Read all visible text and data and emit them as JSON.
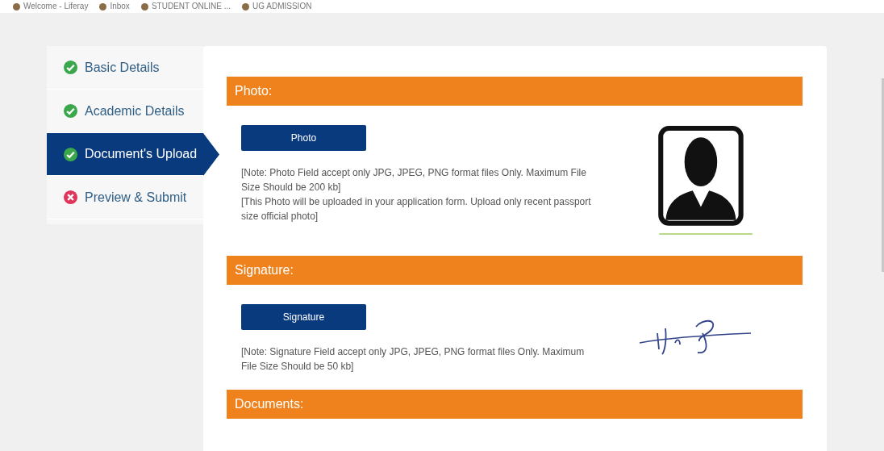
{
  "bookmarks": [
    {
      "label": "Welcome - Liferay"
    },
    {
      "label": "Inbox"
    },
    {
      "label": "STUDENT ONLINE ..."
    },
    {
      "label": "UG ADMISSION"
    }
  ],
  "steps": [
    {
      "label": "Basic Details",
      "kind": "done",
      "selected": false
    },
    {
      "label": "Academic Details",
      "kind": "done",
      "selected": false
    },
    {
      "label": "Document's Upload",
      "kind": "done",
      "selected": true
    },
    {
      "label": "Preview & Submit",
      "kind": "error",
      "selected": false
    }
  ],
  "sections": [
    {
      "title": "Photo:",
      "kind": "photo",
      "button": "Photo",
      "notes": [
        "[Note: Photo Field accept only JPG, JPEG, PNG format files Only. Maximum File Size Should be 200 kb]",
        "[This Photo will be uploaded in your application form. Upload only recent passport size official photo]"
      ]
    },
    {
      "title": "Signature:",
      "kind": "signature",
      "button": "Signature",
      "notes": [
        "[Note: Signature Field accept only JPG, JPEG, PNG format files Only. Maximum File Size Should be 50 kb]"
      ]
    },
    {
      "title": "Documents:",
      "kind": "header"
    }
  ]
}
